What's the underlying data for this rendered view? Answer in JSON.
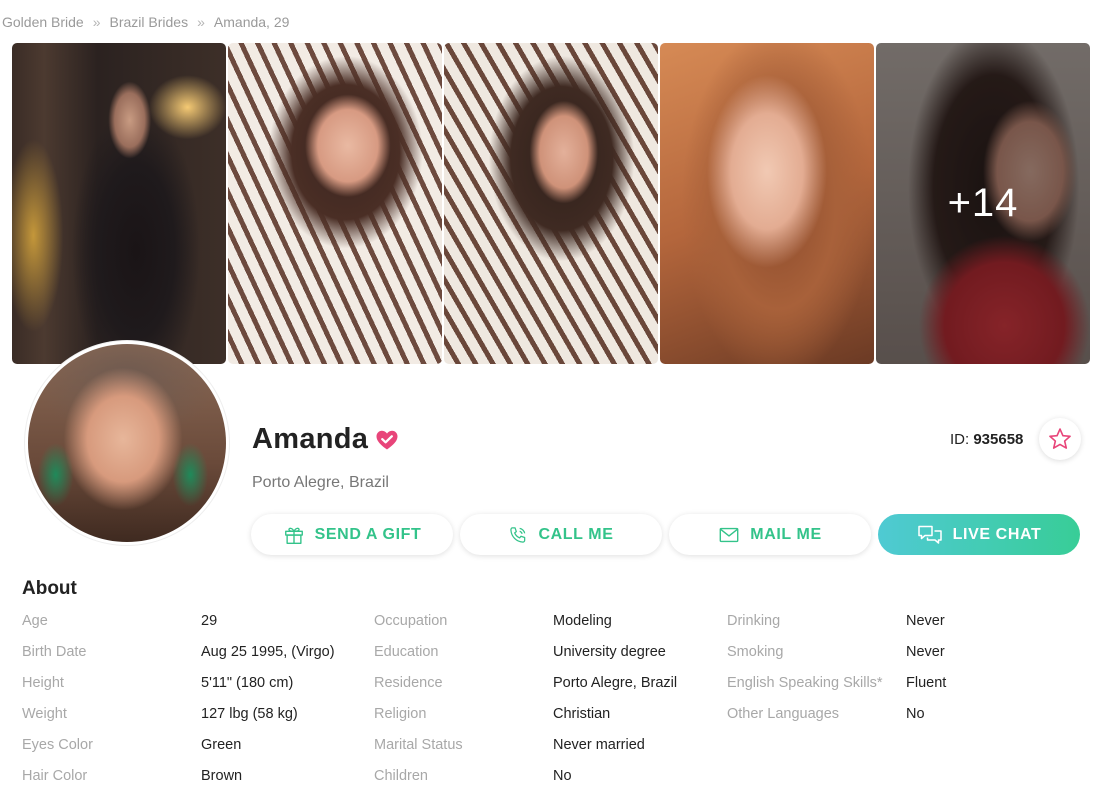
{
  "breadcrumb": [
    "Golden Bride",
    "Brazil Brides",
    "Amanda, 29"
  ],
  "gallery": {
    "more_count": "+14"
  },
  "profile": {
    "name": "Amanda",
    "location": "Porto Alegre, Brazil",
    "id_label": "ID:",
    "id_value": "935658"
  },
  "actions": {
    "gift": "SEND A GIFT",
    "call": "CALL ME",
    "mail": "MAIL ME",
    "chat": "LIVE CHAT"
  },
  "about": {
    "title": "About",
    "col1": [
      {
        "label": "Age",
        "value": "29"
      },
      {
        "label": "Birth Date",
        "value": "Aug 25 1995, (Virgo)"
      },
      {
        "label": "Height",
        "value": "5'11\" (180 cm)"
      },
      {
        "label": "Weight",
        "value": "127 lbg (58 kg)"
      },
      {
        "label": "Eyes Color",
        "value": "Green"
      },
      {
        "label": "Hair Color",
        "value": "Brown"
      }
    ],
    "col2": [
      {
        "label": "Occupation",
        "value": "Modeling"
      },
      {
        "label": "Education",
        "value": "University degree"
      },
      {
        "label": "Residence",
        "value": "Porto Alegre, Brazil"
      },
      {
        "label": "Religion",
        "value": "Christian"
      },
      {
        "label": "Marital Status",
        "value": "Never married"
      },
      {
        "label": "Children",
        "value": "No"
      }
    ],
    "col3": [
      {
        "label": "Drinking",
        "value": "Never"
      },
      {
        "label": "Smoking",
        "value": "Never"
      },
      {
        "label": "English Speaking Skills*",
        "value": "Fluent"
      },
      {
        "label": "Other Languages",
        "value": "No"
      }
    ]
  },
  "colors": {
    "accent": "#33c38a",
    "verified": "#e8457a",
    "chat_gradient_start": "#4fcad3",
    "chat_gradient_end": "#38cd97"
  }
}
